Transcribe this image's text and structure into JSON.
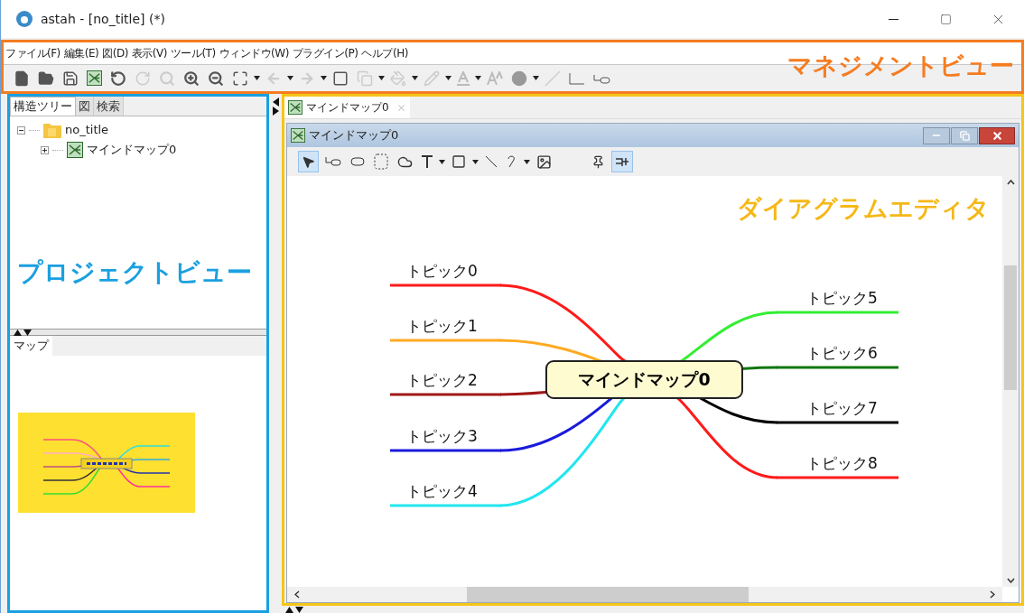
{
  "window": {
    "title": "astah - [no_title] (*)"
  },
  "menu": [
    "ファイル(F)",
    "編集(E)",
    "図(D)",
    "表示(V)",
    "ツール(T)",
    "ウィンドウ(W)",
    "プラグイン(P)",
    "ヘルプ(H)"
  ],
  "management_label": "マネジメントビュー",
  "project_tabs": [
    {
      "label": "構造ツリー",
      "selected": true
    },
    {
      "label": "図",
      "selected": false
    },
    {
      "label": "検索",
      "selected": false
    }
  ],
  "tree": [
    {
      "label": "no_title",
      "kind": "project",
      "expanded": true,
      "children": [
        {
          "label": "マインドマップ0",
          "kind": "mindmap",
          "expanded": false
        }
      ]
    }
  ],
  "project_label": "プロジェクトビュー",
  "map_tab": {
    "label": "マップ"
  },
  "editor_tab": {
    "label": "マインドマップ0"
  },
  "diagram_window": {
    "title": "マインドマップ0"
  },
  "diagram_label": "ダイアグラムエディタ",
  "mindmap": {
    "center": "マインドマップ0",
    "left_topics": [
      {
        "text": "トピック0",
        "color": "#ff1a1a"
      },
      {
        "text": "トピック1",
        "color": "#ffaa22"
      },
      {
        "text": "トピック2",
        "color": "#a01818"
      },
      {
        "text": "トピック3",
        "color": "#1a1adc"
      },
      {
        "text": "トピック4",
        "color": "#22e6ee"
      }
    ],
    "right_topics": [
      {
        "text": "トピック5",
        "color": "#33ee33"
      },
      {
        "text": "トピック6",
        "color": "#117711"
      },
      {
        "text": "トピック7",
        "color": "#000000"
      },
      {
        "text": "トピック8",
        "color": "#ff1a1a"
      }
    ]
  }
}
